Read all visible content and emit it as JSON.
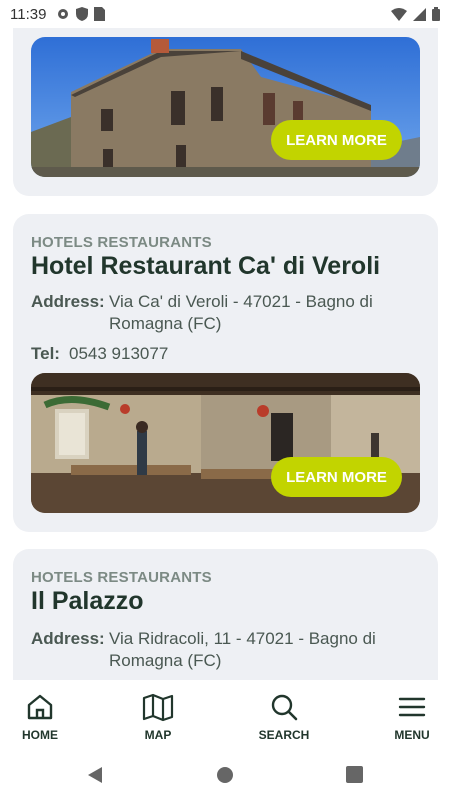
{
  "status_bar": {
    "time": "11:39",
    "icons": [
      "gear-icon",
      "shield-icon",
      "sim-card-icon",
      "wifi-icon",
      "cell-signal-icon",
      "battery-icon"
    ]
  },
  "cards": [
    {
      "image": "stone farmhouse exterior under blue sky",
      "learn_more": "LEARN MORE"
    },
    {
      "category": "HOTELS RESTAURANTS",
      "title": "Hotel Restaurant Ca' di Veroli",
      "address_label": "Address:",
      "address_line1": "Via Ca' di Veroli - 47021 - Bagno di",
      "address_line2": "Romagna (FC)",
      "tel_label": "Tel:",
      "tel_value": "0543 913077",
      "image": "rustic restaurant dining room with wooden tables",
      "learn_more": "LEARN MORE"
    },
    {
      "category": "HOTELS RESTAURANTS",
      "title": "Il Palazzo",
      "address_label": "Address:",
      "address_line1": "Via Ridracoli, 11 - 47021 - Bagno di",
      "address_line2": "Romagna (FC)"
    }
  ],
  "bottom_nav": {
    "items": [
      {
        "label": "HOME",
        "icon": "home-icon"
      },
      {
        "label": "MAP",
        "icon": "map-icon"
      },
      {
        "label": "SEARCH",
        "icon": "search-icon"
      },
      {
        "label": "MENU",
        "icon": "hamburger-menu-icon"
      }
    ]
  },
  "colors": {
    "accent": "#c2d400",
    "card_bg": "#eef0f4",
    "title": "#21362c",
    "category": "#7c8a84"
  }
}
